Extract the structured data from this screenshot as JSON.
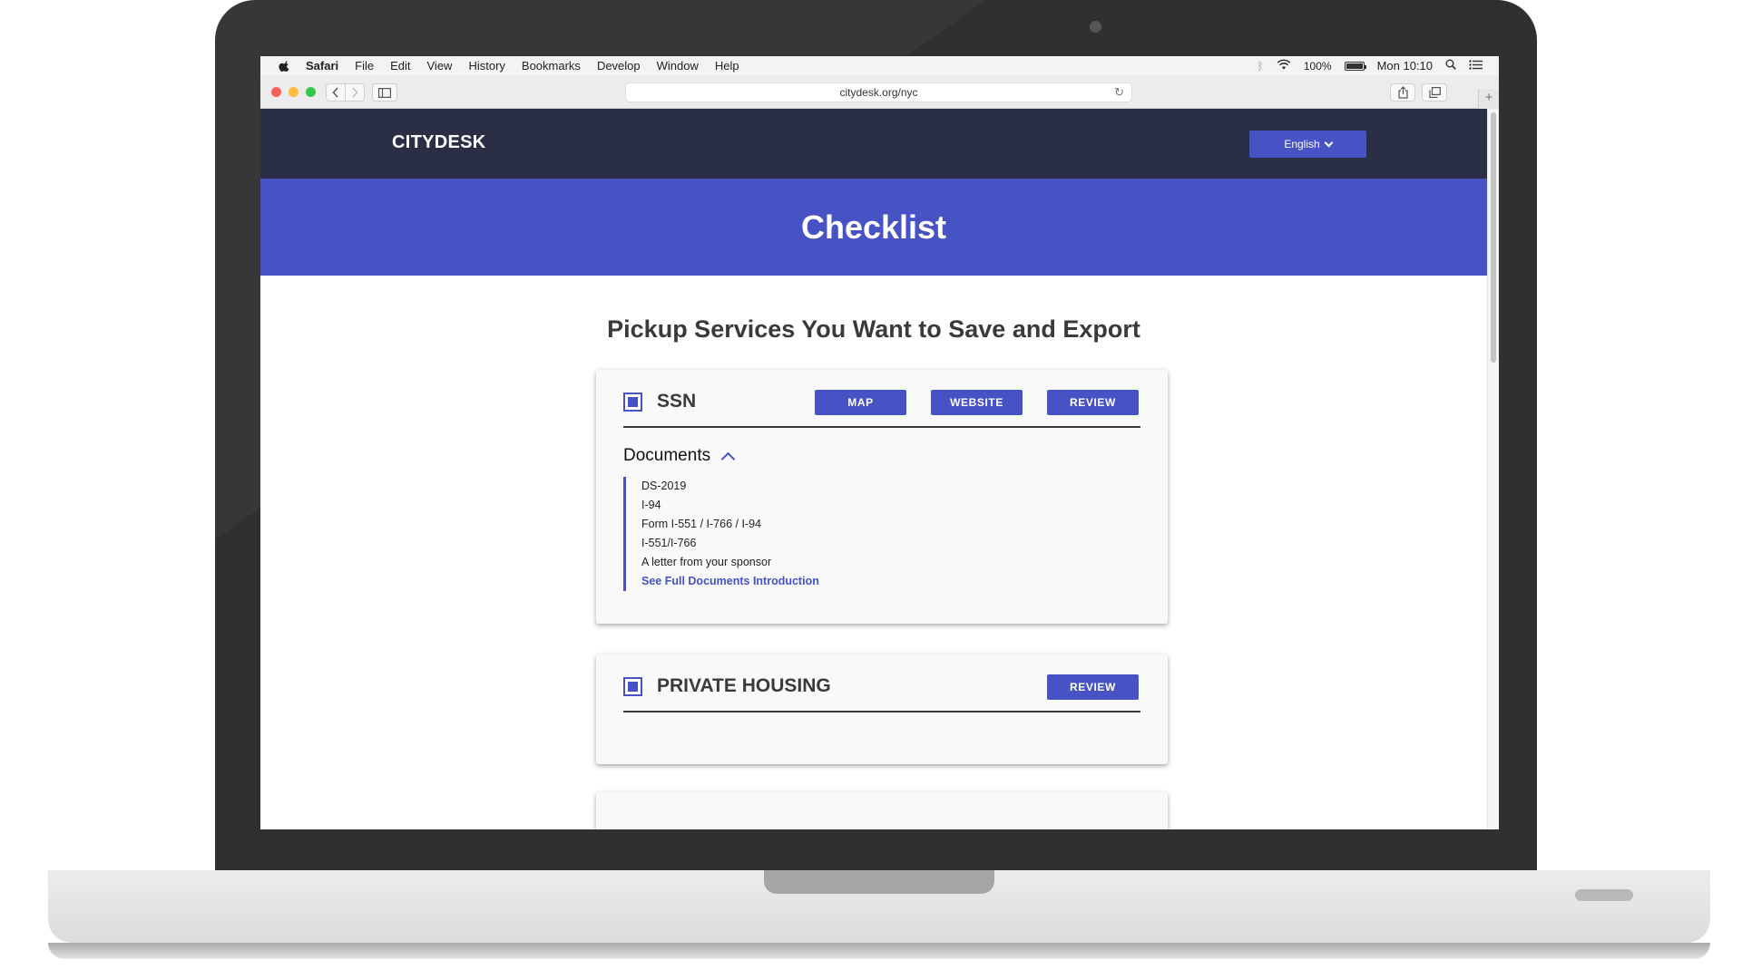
{
  "menubar": {
    "items": [
      "Safari",
      "File",
      "Edit",
      "View",
      "History",
      "Bookmarks",
      "Develop",
      "Window",
      "Help"
    ],
    "battery": "100%",
    "clock": "Mon 10:10"
  },
  "browser": {
    "url": "citydesk.org/nyc"
  },
  "header": {
    "logo": "CITYDESK",
    "language": "English"
  },
  "hero": {
    "title": "Checklist"
  },
  "main": {
    "subtitle": "Pickup Services You Want to Save and Export",
    "cards": [
      {
        "title": "SSN",
        "checked": true,
        "buttons": [
          "MAP",
          "WEBSITE",
          "REVIEW"
        ],
        "documents_heading": "Documents",
        "documents": [
          "DS-2019",
          "I-94",
          "Form I-551 / I-766 / I-94",
          "I-551/I-766",
          "A letter from your sponsor"
        ],
        "documents_link": "See Full Documents Introduction"
      },
      {
        "title": "PRIVATE HOUSING",
        "checked": true,
        "buttons": [
          "REVIEW"
        ]
      }
    ]
  },
  "colors": {
    "accent": "#4752c4",
    "header_bg": "#2b2f45",
    "text_dark": "#3a3a3a"
  }
}
